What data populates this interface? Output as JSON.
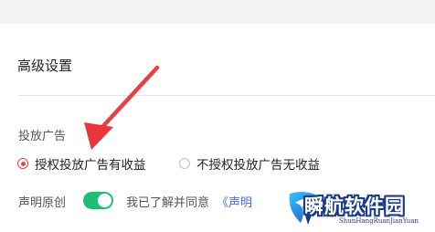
{
  "section": {
    "title": "高级设置"
  },
  "ad_setting": {
    "label": "投放广告",
    "options": [
      {
        "label": "授权投放广告有收益",
        "checked": true
      },
      {
        "label": "不授权投放广告无收益",
        "checked": false
      }
    ]
  },
  "declaration": {
    "label": "声明原创",
    "toggle_on": true,
    "agree_text": "我已了解并同意",
    "agree_link": "《声明"
  },
  "watermark": {
    "title": "瞬航软件园",
    "subtitle": "ShunHangRuanJianYuan"
  },
  "colors": {
    "accent_red": "#f04142",
    "toggle_green": "#1dbf73",
    "link_blue": "#4a6fd8",
    "arrow_red": "#e8363a"
  }
}
